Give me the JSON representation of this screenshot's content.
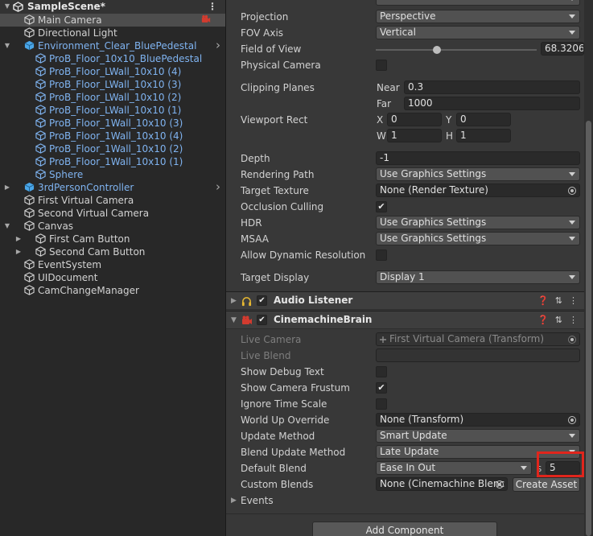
{
  "hierarchy": {
    "scene_name": "SampleScene*",
    "items": [
      {
        "label": "Main Camera"
      },
      {
        "label": "Directional Light"
      },
      {
        "label": "Environment_Clear_BluePedestal"
      },
      {
        "label": "ProB_Floor_10x10_BluePedestal"
      },
      {
        "label": "ProB_Floor_LWall_10x10 (4)"
      },
      {
        "label": "ProB_Floor_LWall_10x10 (3)"
      },
      {
        "label": "ProB_Floor_LWall_10x10 (2)"
      },
      {
        "label": "ProB_Floor_LWall_10x10 (1)"
      },
      {
        "label": "ProB_Floor_1Wall_10x10 (3)"
      },
      {
        "label": "ProB_Floor_1Wall_10x10 (4)"
      },
      {
        "label": "ProB_Floor_1Wall_10x10 (2)"
      },
      {
        "label": "ProB_Floor_1Wall_10x10 (1)"
      },
      {
        "label": "Sphere"
      },
      {
        "label": "3rdPersonController"
      },
      {
        "label": "First Virtual Camera"
      },
      {
        "label": "Second Virtual Camera"
      },
      {
        "label": "Canvas"
      },
      {
        "label": "First Cam Button"
      },
      {
        "label": "Second Cam Button"
      },
      {
        "label": "EventSystem"
      },
      {
        "label": "UIDocument"
      },
      {
        "label": "CamChangeManager"
      }
    ]
  },
  "camera": {
    "projection_label": "Projection",
    "projection_value": "Perspective",
    "fov_axis_label": "FOV Axis",
    "fov_axis_value": "Vertical",
    "fov_label": "Field of View",
    "fov_value": "68.3206",
    "physical_label": "Physical Camera",
    "clipping_label": "Clipping Planes",
    "near_label": "Near",
    "near_value": "0.3",
    "far_label": "Far",
    "far_value": "1000",
    "viewport_label": "Viewport Rect",
    "x_label": "X",
    "x_value": "0",
    "y_label": "Y",
    "y_value": "0",
    "w_label": "W",
    "w_value": "1",
    "h_label": "H",
    "h_value": "1",
    "depth_label": "Depth",
    "depth_value": "-1",
    "rendering_path_label": "Rendering Path",
    "rendering_path_value": "Use Graphics Settings",
    "target_texture_label": "Target Texture",
    "target_texture_value": "None (Render Texture)",
    "occlusion_label": "Occlusion Culling",
    "hdr_label": "HDR",
    "hdr_value": "Use Graphics Settings",
    "msaa_label": "MSAA",
    "msaa_value": "Use Graphics Settings",
    "dynres_label": "Allow Dynamic Resolution",
    "target_display_label": "Target Display",
    "target_display_value": "Display 1"
  },
  "audio_listener": {
    "title": "Audio Listener"
  },
  "brain": {
    "title": "CinemachineBrain",
    "live_camera_label": "Live Camera",
    "live_camera_value": "First Virtual Camera (Transform)",
    "live_blend_label": "Live Blend",
    "debug_text_label": "Show Debug Text",
    "frustum_label": "Show Camera Frustum",
    "ignore_time_label": "Ignore Time Scale",
    "world_up_label": "World Up Override",
    "world_up_value": "None (Transform)",
    "update_method_label": "Update Method",
    "update_method_value": "Smart Update",
    "blend_update_label": "Blend Update Method",
    "blend_update_value": "Late Update",
    "default_blend_label": "Default Blend",
    "default_blend_value": "Ease In Out",
    "seconds_label": "s",
    "seconds_value": "5",
    "custom_blends_label": "Custom Blends",
    "custom_blends_value": "None (Cinemachine Blenc",
    "create_asset_label": "Create Asset",
    "events_label": "Events"
  },
  "add_component_label": "Add Component",
  "colors": {
    "highlight": "#e0251c",
    "link_blue": "#7fb3f0",
    "panel": "#383838",
    "hierarchy": "#282828"
  }
}
